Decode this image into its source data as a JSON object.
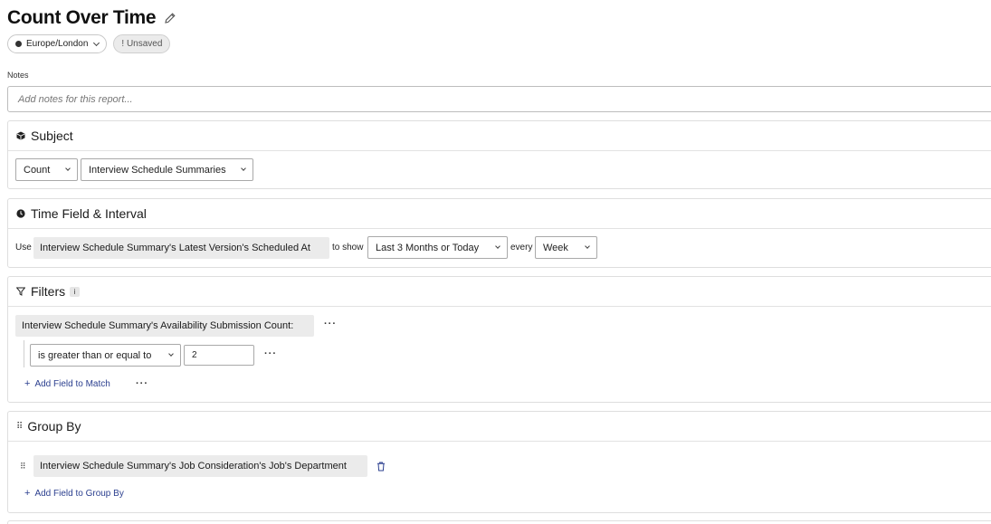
{
  "header": {
    "title": "Count Over Time",
    "timezone": "Europe/London",
    "status": "! Unsaved"
  },
  "notes": {
    "label": "Notes",
    "placeholder": "Add notes for this report..."
  },
  "subject": {
    "title": "Subject",
    "aggregate": "Count",
    "source": "Interview Schedule Summaries"
  },
  "time": {
    "title": "Time Field & Interval",
    "use_label": "Use",
    "field": "Interview Schedule Summary's Latest Version's Scheduled At",
    "to_show_label": "to show",
    "range": "Last 3 Months or Today",
    "every_label": "every",
    "interval": "Week"
  },
  "filters": {
    "title": "Filters",
    "info": "i",
    "field": "Interview Schedule Summary's Availability Submission Count:",
    "operator": "is greater than or equal to",
    "value": "2",
    "more": "···",
    "add_label": "Add Field to Match"
  },
  "group_by": {
    "title": "Group By",
    "field": "Interview Schedule Summary's Job Consideration's Job's Department",
    "add_label": "Add Field to Group By"
  },
  "colors": {
    "link": "#2b3f8f",
    "pill_bg": "#ebebeb",
    "border": "#dedede"
  }
}
